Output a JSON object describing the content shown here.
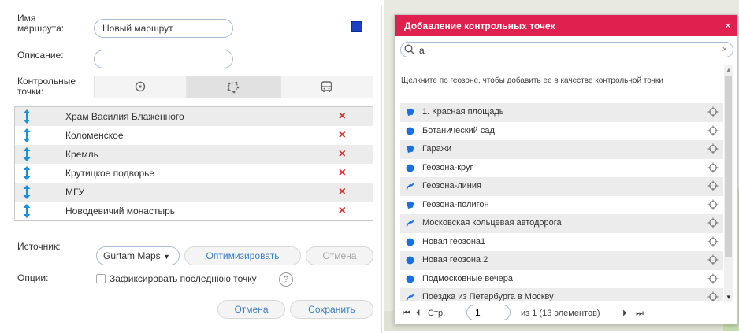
{
  "route_form": {
    "name_label": "Имя маршрута:",
    "name_value": "Новый маршрут",
    "route_color": "#1c3fc7",
    "description_label": "Описание:",
    "description_value": "",
    "checkpoints_label": "Контрольные точки:",
    "tab_icons": [
      "point-icon",
      "geofence-icon",
      "bus-icon"
    ],
    "active_tab": 1,
    "checkpoints": [
      {
        "name": "Храм Василия Блаженного"
      },
      {
        "name": "Коломенское"
      },
      {
        "name": "Кремль"
      },
      {
        "name": "Крутицкое подворье"
      },
      {
        "name": "МГУ"
      },
      {
        "name": "Новодевичий монастырь"
      }
    ],
    "source_label": "Источник:",
    "source_value": "Gurtam Maps",
    "optimize_label": "Оптимизировать",
    "source_cancel_label": "Отмена",
    "options_label": "Опции:",
    "fix_last_point_label": "Зафиксировать последнюю точку",
    "fix_last_point_checked": false,
    "help_glyph": "?",
    "cancel_label": "Отмена",
    "save_label": "Сохранить"
  },
  "dialog": {
    "title": "Добавление контрольных точек",
    "close_glyph": "×",
    "search_value": "а",
    "clear_glyph": "×",
    "hint": "Щелкните по геозоне, чтобы добавить ее в качестве контрольной точки",
    "accent_color": "#e0214f",
    "geofences": [
      {
        "name": "1. Красная площадь",
        "icon": "polygon"
      },
      {
        "name": "Ботанический сад",
        "icon": "circle"
      },
      {
        "name": "Гаражи",
        "icon": "polygon"
      },
      {
        "name": "Геозона-круг",
        "icon": "circle"
      },
      {
        "name": "Геозона-линия",
        "icon": "line"
      },
      {
        "name": "Геозона-полигон",
        "icon": "polygon"
      },
      {
        "name": "Московская кольцевая автодорога",
        "icon": "line"
      },
      {
        "name": "Новая геозона1",
        "icon": "circle"
      },
      {
        "name": "Новая геозона 2",
        "icon": "circle"
      },
      {
        "name": "Подмосковные вечера",
        "icon": "circle"
      },
      {
        "name": "Поездка из Петербурга в Москву",
        "icon": "line"
      }
    ],
    "pager": {
      "page_label": "Стр.",
      "page_value": "1",
      "of_label": "из 1 (13 элементов)"
    }
  }
}
